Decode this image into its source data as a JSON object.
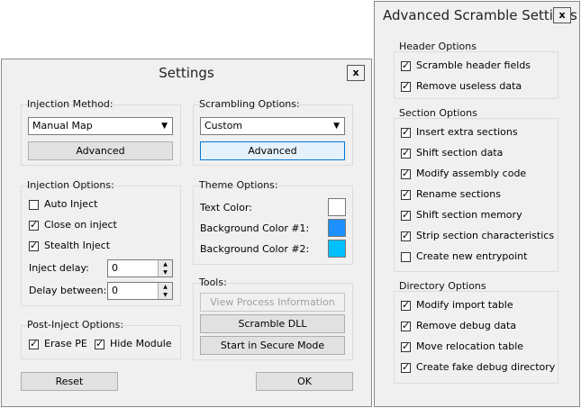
{
  "settings": {
    "title": "Settings",
    "close": "x",
    "injection_method": {
      "label": "Injection Method:",
      "selected": "Manual Map",
      "advanced": "Advanced"
    },
    "scrambling": {
      "label": "Scrambling Options:",
      "selected": "Custom",
      "advanced": "Advanced"
    },
    "injection_options": {
      "label": "Injection Options:",
      "auto_inject": {
        "label": "Auto Inject",
        "checked": false
      },
      "close_on_inject": {
        "label": "Close on inject",
        "checked": true
      },
      "stealth_inject": {
        "label": "Stealth Inject",
        "checked": true
      },
      "inject_delay": {
        "label": "Inject delay:",
        "value": "0"
      },
      "delay_between": {
        "label": "Delay between:",
        "value": "0"
      }
    },
    "theme": {
      "label": "Theme Options:",
      "text_color": {
        "label": "Text Color:",
        "color": "#ffffff"
      },
      "bg1": {
        "label": "Background Color #1:",
        "color": "#1e90ff"
      },
      "bg2": {
        "label": "Background Color #2:",
        "color": "#00bfff"
      }
    },
    "tools": {
      "label": "Tools:",
      "view_process": "View Process Information",
      "scramble_dll": "Scramble DLL",
      "secure_mode": "Start in Secure Mode"
    },
    "post_inject": {
      "label": "Post-Inject Options:",
      "erase_pe": {
        "label": "Erase PE",
        "checked": true
      },
      "hide_module": {
        "label": "Hide Module",
        "checked": true
      }
    },
    "reset": "Reset",
    "ok": "OK"
  },
  "advanced": {
    "title": "Advanced Scramble Settings",
    "close": "x",
    "header": {
      "label": "Header Options",
      "items": [
        {
          "label": "Scramble header fields",
          "checked": true
        },
        {
          "label": "Remove useless data",
          "checked": true
        }
      ]
    },
    "section": {
      "label": "Section Options",
      "items": [
        {
          "label": "Insert extra sections",
          "checked": true
        },
        {
          "label": "Shift section data",
          "checked": true
        },
        {
          "label": "Modify assembly code",
          "checked": true
        },
        {
          "label": "Rename sections",
          "checked": true
        },
        {
          "label": "Shift section memory",
          "checked": true
        },
        {
          "label": "Strip section characteristics",
          "checked": true
        },
        {
          "label": "Create new entrypoint",
          "checked": false
        }
      ]
    },
    "directory": {
      "label": "Directory Options",
      "items": [
        {
          "label": "Modify import table",
          "checked": true
        },
        {
          "label": "Remove debug data",
          "checked": true
        },
        {
          "label": "Move relocation table",
          "checked": true
        },
        {
          "label": "Create fake debug directory",
          "checked": true
        }
      ]
    }
  }
}
